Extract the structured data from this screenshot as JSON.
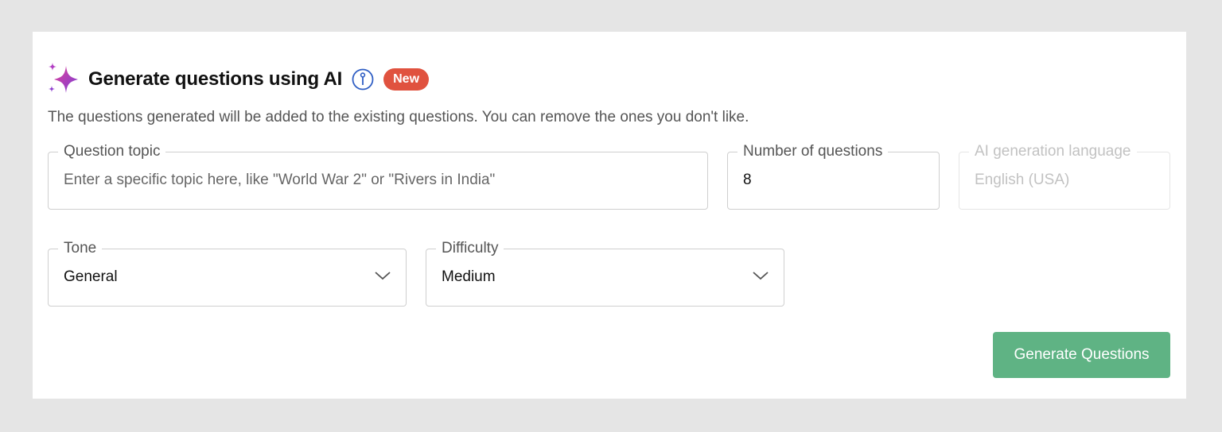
{
  "header": {
    "title": "Generate questions using AI",
    "badge": "New",
    "subtitle": "The questions generated will be added to the existing questions. You can remove the ones you don't like."
  },
  "fields": {
    "topic": {
      "label": "Question topic",
      "placeholder": "Enter a specific topic here, like \"World War 2\" or \"Rivers in India\"",
      "value": ""
    },
    "count": {
      "label": "Number of questions",
      "value": "8"
    },
    "language": {
      "label": "AI generation language",
      "value": "English (USA)",
      "disabled": true
    },
    "tone": {
      "label": "Tone",
      "value": "General"
    },
    "difficulty": {
      "label": "Difficulty",
      "value": "Medium"
    }
  },
  "actions": {
    "generate_label": "Generate Questions"
  },
  "icons": {
    "sparkle": "sparkle-icon",
    "info": "info-icon",
    "chevron": "chevron-down-icon"
  },
  "colors": {
    "badge": "#e0523f",
    "button": "#5fb384",
    "sparkle_start": "#e2409a",
    "sparkle_end": "#7a3fd6",
    "info": "#2f5ec4"
  }
}
